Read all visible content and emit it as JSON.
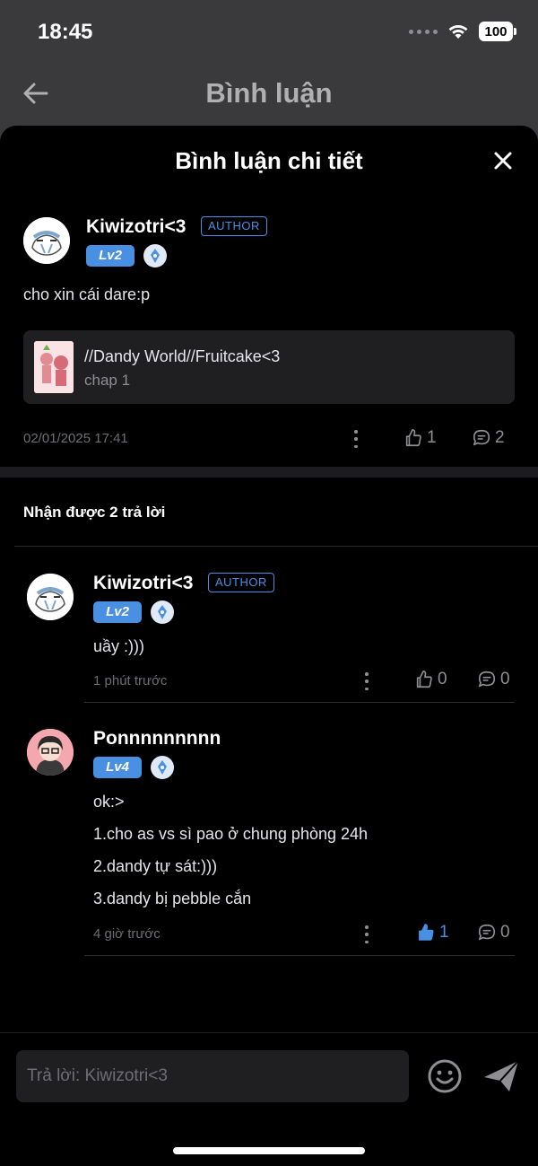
{
  "status": {
    "time": "18:45",
    "battery": "100"
  },
  "background": {
    "title": "Bình luận"
  },
  "sheet": {
    "title": "Bình luận chi tiết"
  },
  "main_comment": {
    "username": "Kiwizotri<3",
    "author_badge": "AUTHOR",
    "level": "Lv2",
    "text": "cho xin cái dare:p",
    "ref_title": "//Dandy World//Fruitcake<3",
    "ref_sub": "chap 1",
    "timestamp": "02/01/2025 17:41",
    "likes": "1",
    "replies": "2"
  },
  "replies_heading": "Nhận được 2 trả lời",
  "replies": [
    {
      "username": "Kiwizotri<3",
      "author_badge": "AUTHOR",
      "level": "Lv2",
      "lines": [
        "uầy :)))"
      ],
      "time": "1 phút trước",
      "likes": "0",
      "comments": "0"
    },
    {
      "username": "Ponnnnnnnnn",
      "level": "Lv4",
      "lines": [
        "ok:>",
        "1.cho as vs sì pao ở chung phòng 24h",
        "2.dandy tự sát:)))",
        "3.dandy bị pebble cắn"
      ],
      "time": "4 giờ trước",
      "likes": "1",
      "comments": "0"
    }
  ],
  "input": {
    "placeholder": "Trả lời: Kiwizotri<3"
  },
  "colors": {
    "accent": "#4a90e2",
    "sheet_bg": "#000000",
    "card_bg": "#1f1f21"
  }
}
